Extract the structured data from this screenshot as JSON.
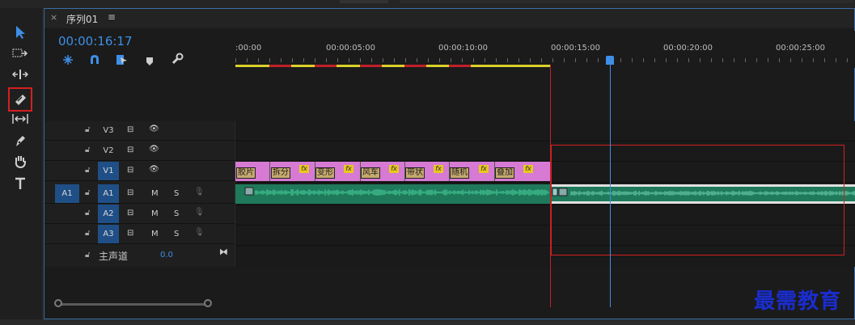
{
  "panel": {
    "close_glyph": "×",
    "sequence_title": "序列01",
    "menu_glyph": "≡",
    "timecode": "00:00:16:17"
  },
  "ruler": {
    "ticks": [
      ":00:00",
      "00:00:05:00",
      "00:00:10:00",
      "00:00:15:00",
      "00:00:20:00",
      "00:00:25:00"
    ]
  },
  "tracks": {
    "video": [
      {
        "name": "V3"
      },
      {
        "name": "V2"
      },
      {
        "name": "V1",
        "source": ""
      }
    ],
    "audio": [
      {
        "name": "A1",
        "source": "A1",
        "m": "M",
        "s": "S"
      },
      {
        "name": "A2",
        "m": "M",
        "s": "S"
      },
      {
        "name": "A3",
        "m": "M",
        "s": "S"
      }
    ],
    "master": {
      "label": "主声道",
      "value": "0.0"
    }
  },
  "clips": {
    "video_labels": [
      "胶片",
      "拆分",
      "变形",
      "风车",
      "带状",
      "随机",
      "叠加"
    ],
    "fx_badge": "fx"
  },
  "colors": {
    "accent": "#3e8fe6",
    "video_clip": "#d67ad3",
    "audio_clip": "#1e7a5a",
    "highlight": "#d42020",
    "work_area": "#d9d02a"
  },
  "watermark": "最需教育",
  "icons": {
    "tools": [
      "selection-tool-icon",
      "track-select-icon",
      "ripple-edit-icon",
      "razor-tool-icon",
      "slip-tool-icon",
      "pen-tool-icon",
      "hand-tool-icon",
      "type-tool-icon"
    ]
  }
}
